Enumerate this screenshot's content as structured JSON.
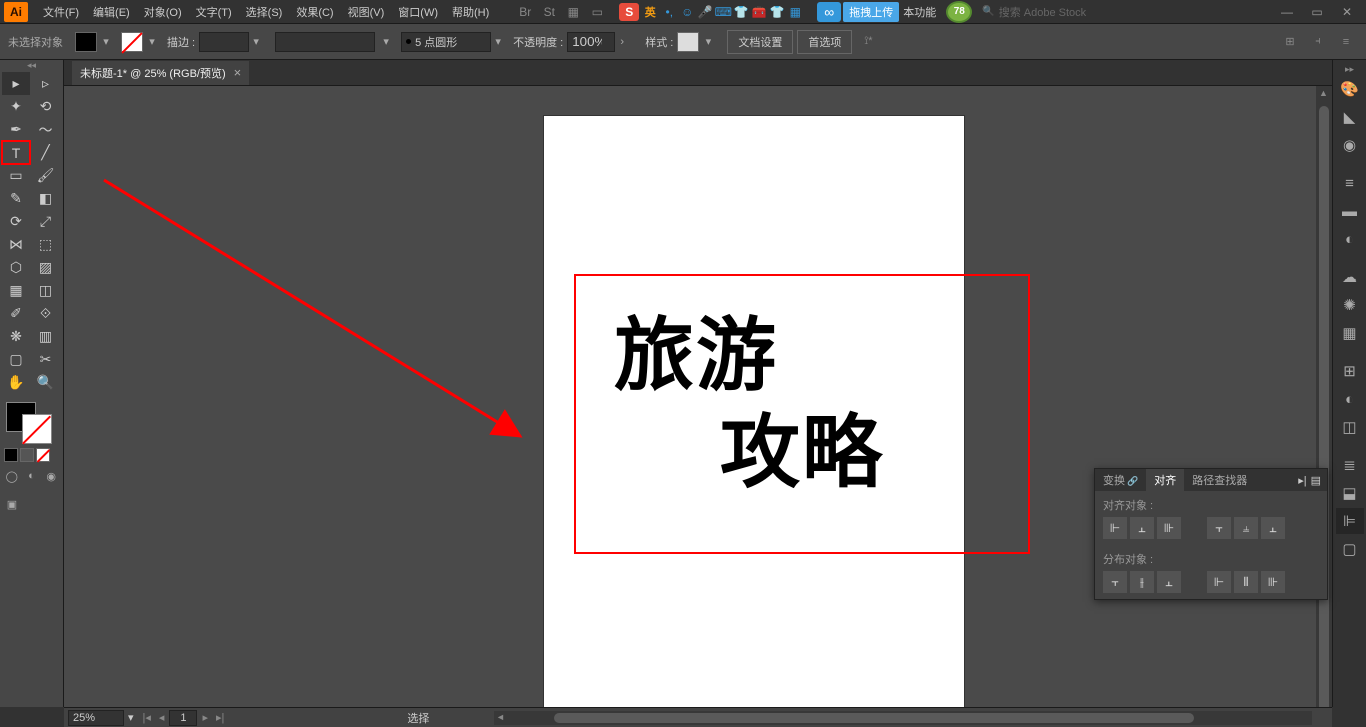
{
  "app": {
    "logo": "Ai"
  },
  "menu": {
    "file": "文件(F)",
    "edit": "编辑(E)",
    "object": "对象(O)",
    "type": "文字(T)",
    "select": "选择(S)",
    "effect": "效果(C)",
    "view": "视图(V)",
    "window": "窗口(W)",
    "help": "帮助(H)"
  },
  "titlebar": {
    "ime_lang": "英",
    "upload": "拖拽上传",
    "func": "本功能",
    "badge": "78",
    "search_placeholder": "搜索 Adobe Stock"
  },
  "control": {
    "no_selection": "未选择对象",
    "stroke_label": "描边 :",
    "stroke_value": "",
    "brush_profile": "5 点圆形",
    "opacity_label": "不透明度 :",
    "opacity_value": "100%",
    "style_label": "样式 :",
    "doc_setup": "文档设置",
    "prefs": "首选项"
  },
  "document": {
    "tab_title": "未标题-1* @ 25% (RGB/预览)",
    "text_line1": "旅游",
    "text_line2": "攻略"
  },
  "align_panel": {
    "tab_transform": "变换",
    "tab_align": "对齐",
    "tab_pathfinder": "路径查找器",
    "section_align": "对齐对象 :",
    "section_distribute": "分布对象 :"
  },
  "status": {
    "zoom": "25%",
    "page": "1",
    "mode": "选择"
  }
}
